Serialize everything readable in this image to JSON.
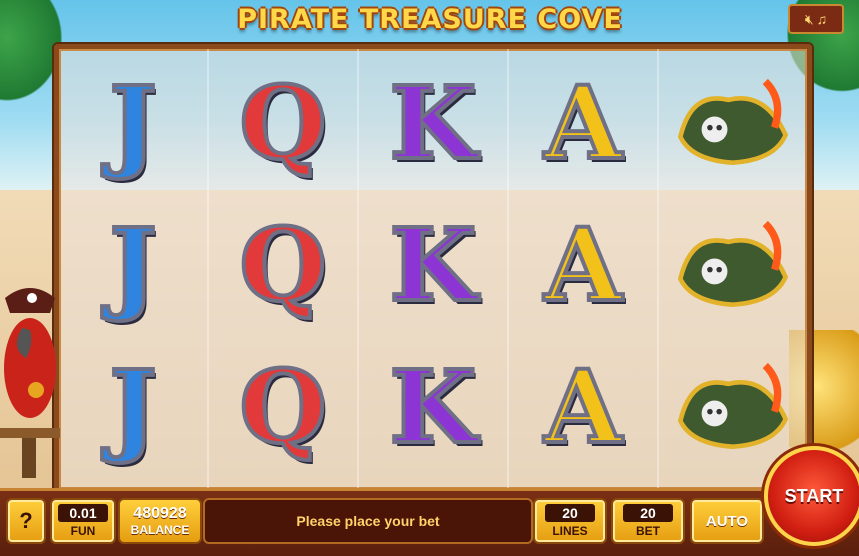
{
  "title": "PIRATE TREASURE COVE",
  "sound_controls": {
    "mute_icon": "speaker-mute-icon",
    "music_icon": "music-note-icon"
  },
  "reels": [
    {
      "symbols": [
        "J",
        "J",
        "J"
      ]
    },
    {
      "symbols": [
        "Q",
        "Q",
        "Q"
      ]
    },
    {
      "symbols": [
        "K",
        "K",
        "K"
      ]
    },
    {
      "symbols": [
        "A",
        "A",
        "A"
      ]
    },
    {
      "symbols": [
        "pirate-hat",
        "pirate-hat",
        "pirate-hat"
      ]
    }
  ],
  "controls": {
    "help_label": "?",
    "coin_value": "0.01",
    "coin_label": "FUN",
    "balance_value": "480928",
    "balance_label": "BALANCE",
    "message": "Please place your bet",
    "lines_value": "20",
    "lines_label": "LINES",
    "bet_value": "20",
    "bet_label": "BET",
    "auto_label": "AUTO",
    "start_label": "START"
  }
}
